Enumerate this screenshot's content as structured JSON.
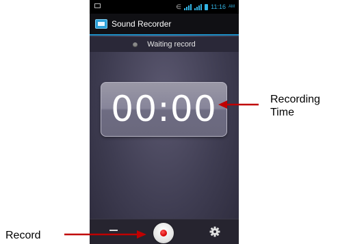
{
  "status_bar": {
    "time": "11:16",
    "ampm": "AM",
    "icons": [
      "image-icon",
      "bluetooth-icon",
      "signal-icon",
      "signal-icon",
      "battery-icon"
    ]
  },
  "app": {
    "title": "Sound Recorder",
    "icon": "sound-recorder-app-icon"
  },
  "recorder": {
    "state": "Waiting record",
    "time": "00:00"
  },
  "bottom_bar": {
    "left_icon": "menu-icon",
    "center_icon": "record-icon",
    "right_icon": "gear-icon"
  },
  "annotations": {
    "recording_time_line1": "Recording",
    "recording_time_line2": "Time",
    "record": "Record"
  },
  "colors": {
    "accent": "#33b5e5",
    "annotation_arrow": "#c00000",
    "record_dot": "#d40000"
  }
}
